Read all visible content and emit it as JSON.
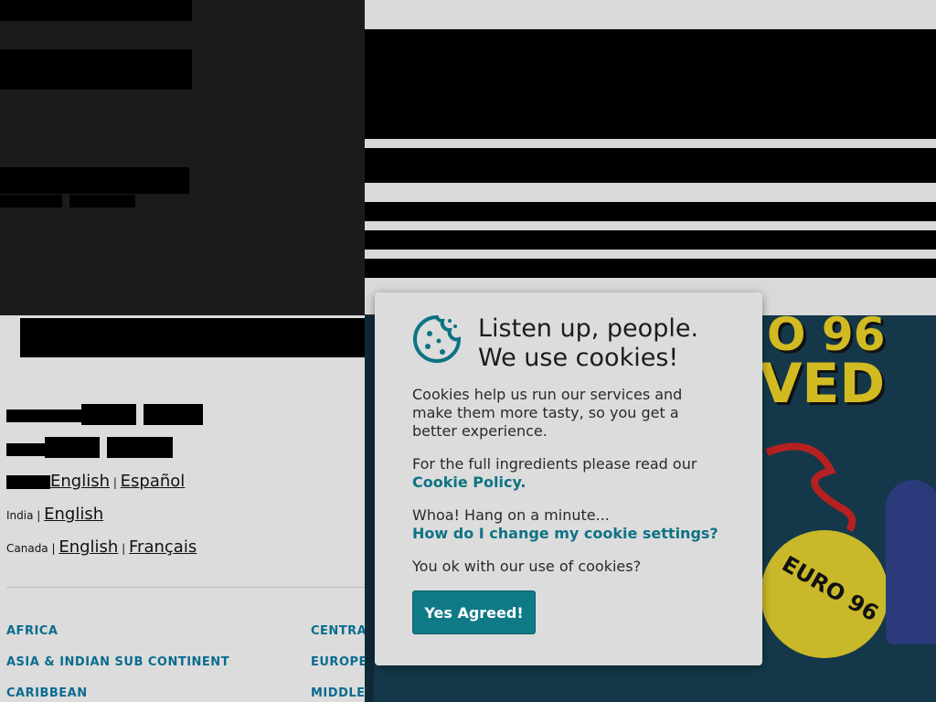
{
  "cookie_modal": {
    "title_line1": "Listen up, people.",
    "title_line2": "We use cookies!",
    "intro": "Cookies help us run our services and make them more tasty, so you get a better experience.",
    "ingredients_text": "For the full ingredients please read our",
    "policy_link": "Cookie Policy.",
    "whoa_text": "Whoa! Hang on a minute...",
    "settings_link": "How do I change my cookie settings?",
    "question": "You ok with our use of cookies?",
    "agree_button": "Yes Agreed!",
    "icon": "cookie-icon"
  },
  "languages": {
    "row1": {
      "country": "",
      "langs": [
        "English",
        "Español"
      ]
    },
    "india": {
      "country": "India",
      "langs": [
        "English"
      ]
    },
    "canada": {
      "country": "Canada",
      "langs": [
        "English",
        "Français"
      ]
    }
  },
  "regions": {
    "col1": [
      "AFRICA",
      "ASIA & INDIAN SUB CONTINENT",
      "CARIBBEAN"
    ],
    "col2": [
      "CENTRA",
      "EUROPE",
      "MIDDLE"
    ]
  },
  "hero": {
    "line1": "O 96",
    "line2": "VED",
    "badge": "EURO 96"
  },
  "colors": {
    "accent": "#0f7a86",
    "link": "#0d7384",
    "region": "#0a6c8f"
  }
}
